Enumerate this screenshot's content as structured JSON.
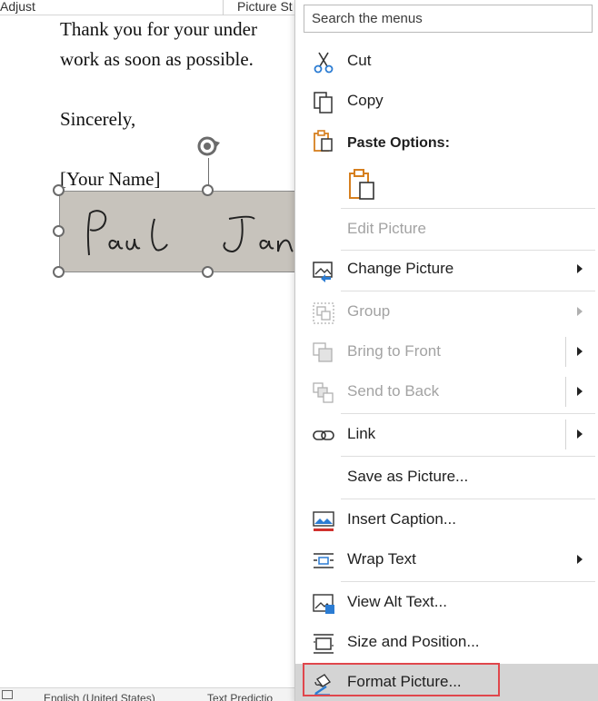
{
  "ribbon": {
    "adjust_label": "Adjust",
    "picture_styles_label": "Picture St"
  },
  "document": {
    "line1": "Thank you for your under",
    "line2": "work as soon as possible.",
    "closing": "Sincerely,",
    "name_placeholder": "[Your Name]"
  },
  "status_bar": {
    "language": "English (United States)",
    "text_predictions": "Text Predictio"
  },
  "menu": {
    "search_placeholder": "Search the menus",
    "items": {
      "cut": "Cut",
      "copy": "Copy",
      "paste_options": "Paste Options:",
      "edit_picture": "Edit Picture",
      "change_picture": "Change Picture",
      "group": "Group",
      "bring_to_front": "Bring to Front",
      "send_to_back": "Send to Back",
      "link": "Link",
      "save_as_picture": "Save as Picture...",
      "insert_caption": "Insert Caption...",
      "wrap_text": "Wrap Text",
      "view_alt_text": "View Alt Text...",
      "size_and_position": "Size and Position...",
      "format_picture": "Format Picture..."
    },
    "highlighted_item": "Format Picture...",
    "highlight_outline_color": "#e0474c"
  },
  "colors": {
    "accent_blue": "#2b7cd3",
    "accent_orange": "#d67f1f",
    "disabled_text": "#a3a3a3",
    "signature_bg": "#c7c3bc"
  },
  "icons": {
    "cut": "scissors-icon",
    "copy": "copy-icon",
    "paste": "clipboard-icon",
    "change_picture": "change-picture-icon",
    "group": "group-icon",
    "bring_to_front": "bring-to-front-icon",
    "send_to_back": "send-to-back-icon",
    "link": "link-icon",
    "insert_caption": "insert-caption-icon",
    "wrap_text": "wrap-text-icon",
    "view_alt_text": "alt-text-icon",
    "size_and_position": "size-position-icon",
    "format_picture": "format-picture-icon",
    "rotate": "rotate-handle-icon"
  }
}
